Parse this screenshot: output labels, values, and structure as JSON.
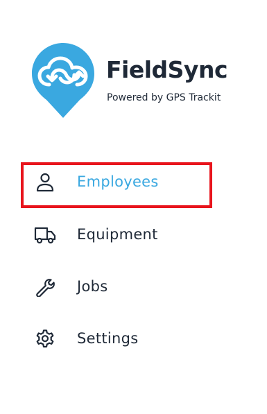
{
  "brand": {
    "name": "FieldSync",
    "tagline": "Powered by GPS Trackit",
    "logo_icon": "cloud-sync-pin-icon",
    "accent_color": "#3aa8e0"
  },
  "nav": {
    "items": [
      {
        "label": "Employees",
        "icon": "person-icon",
        "active": true
      },
      {
        "label": "Equipment",
        "icon": "truck-icon",
        "active": false
      },
      {
        "label": "Jobs",
        "icon": "wrench-icon",
        "active": false
      },
      {
        "label": "Settings",
        "icon": "gear-icon",
        "active": false
      }
    ]
  },
  "annotation": {
    "highlight_color": "#e8141c"
  }
}
